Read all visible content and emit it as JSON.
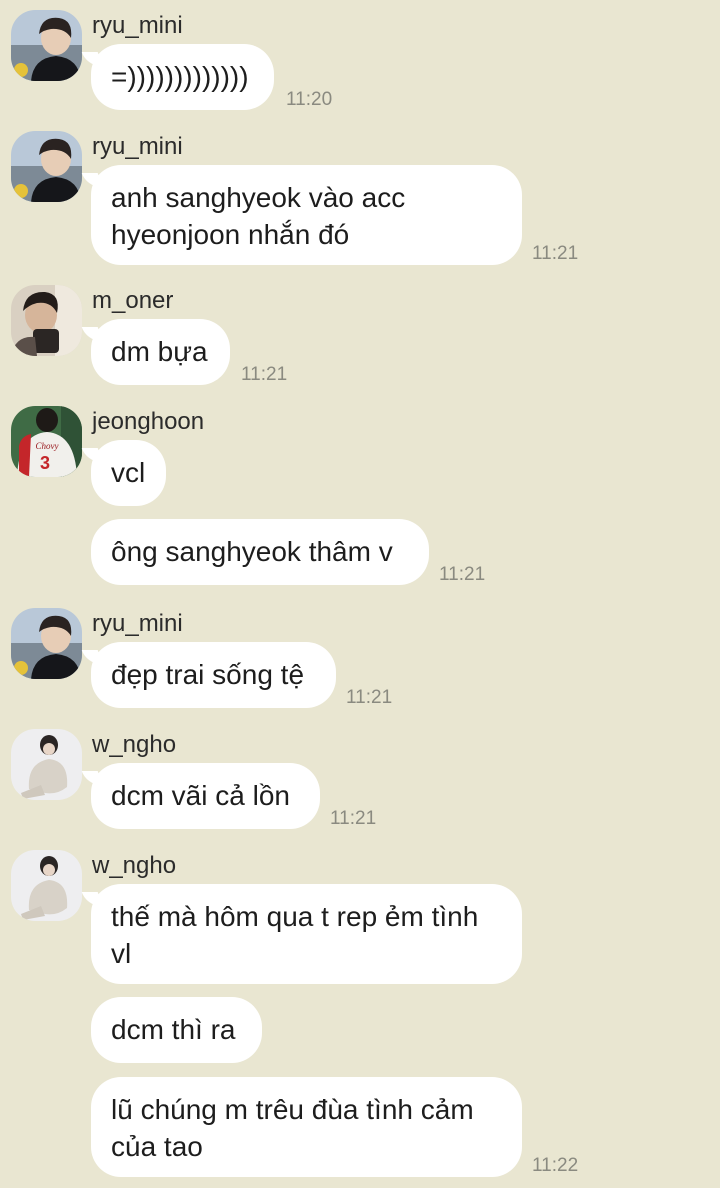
{
  "colors": {
    "background": "#e9e6d1",
    "bubble": "#ffffff",
    "timestamp": "#8a8a80"
  },
  "messages": [
    {
      "sender": "ryu_mini",
      "text": "=)))))))))))))",
      "time": "11:20"
    },
    {
      "sender": "ryu_mini",
      "text": "anh sanghyeok vào acc hyeonjoon nhắn đó",
      "time": "11:21"
    },
    {
      "sender": "m_oner",
      "text": "dm bựa",
      "time": "11:21"
    },
    {
      "sender": "jeonghoon",
      "text": "vcl",
      "time": ""
    },
    {
      "sender": "",
      "text": "ông sanghyeok thâm v",
      "time": "11:21"
    },
    {
      "sender": "ryu_mini",
      "text": "đẹp trai sống tệ",
      "time": "11:21"
    },
    {
      "sender": "w_ngho",
      "text": "dcm vãi cả lồn",
      "time": "11:21"
    },
    {
      "sender": "w_ngho",
      "text": "thế mà hôm qua t rep ẻm tình vl",
      "time": ""
    },
    {
      "sender": "",
      "text": "dcm thì ra",
      "time": ""
    },
    {
      "sender": "",
      "text": "lũ chúng m trêu đùa tình cảm của tao",
      "time": "11:22"
    }
  ],
  "avatars": {
    "ryu_mini": {
      "icon": "person-avatar-icon"
    },
    "m_oner": {
      "icon": "person-avatar-icon"
    },
    "jeonghoon": {
      "icon": "jersey-avatar-icon",
      "jersey_text": "Chovy",
      "jersey_number": "3"
    },
    "w_ngho": {
      "icon": "person-avatar-icon"
    }
  }
}
